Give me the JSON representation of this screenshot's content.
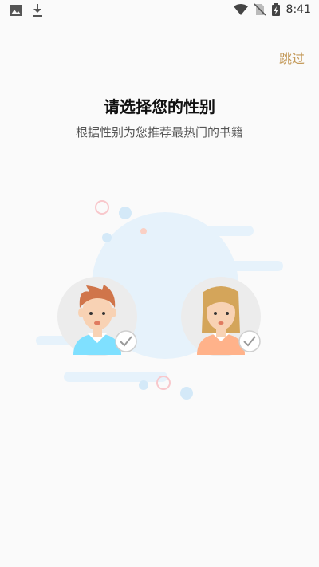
{
  "status_bar": {
    "time": "8:41",
    "left_icons": [
      "image-icon",
      "download-icon"
    ],
    "right_icons": [
      "wifi-icon",
      "no-sim-icon",
      "battery-charging-icon"
    ]
  },
  "header": {
    "skip_label": "跳过"
  },
  "main": {
    "title": "请选择您的性别",
    "subtitle": "根据性别为您推荐最热门的书籍"
  },
  "options": [
    {
      "id": "male",
      "selected": false,
      "icon": "boy-avatar-icon"
    },
    {
      "id": "female",
      "selected": false,
      "icon": "girl-avatar-icon"
    }
  ],
  "colors": {
    "accent": "#c49a5a",
    "bubble": "#e6f2fb",
    "boy_shirt": "#7fe0ff",
    "girl_shirt": "#ffb28a"
  }
}
